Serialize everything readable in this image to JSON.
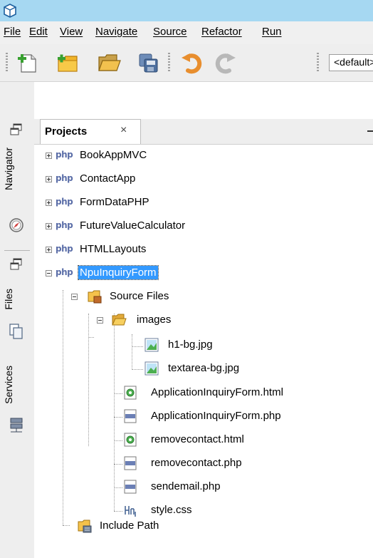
{
  "menubar": {
    "items": [
      "File",
      "Edit",
      "View",
      "Navigate",
      "Source",
      "Refactor",
      "Run"
    ]
  },
  "toolbar": {
    "buttons": [
      "new-file-icon",
      "new-project-icon",
      "open-project-icon",
      "save-all-icon",
      "undo-icon",
      "redo-icon"
    ],
    "config_value": "<default>"
  },
  "side_tabs": {
    "navigator": "Navigator",
    "files": "Files",
    "services": "Services"
  },
  "projects_panel": {
    "tab_label": "Projects",
    "close_glyph": "×",
    "projects": [
      "BookAppMVC",
      "ContactApp",
      "FormDataPHP",
      "FutureValueCalculator",
      "HTMLLayouts",
      "NpuInquiryForm"
    ],
    "php_badge": "php",
    "source_files": "Source Files",
    "images_folder": "images",
    "image_files": [
      "h1-bg.jpg",
      "textarea-bg.jpg"
    ],
    "files": [
      "ApplicationInquiryForm.html",
      "ApplicationInquiryForm.php",
      "removecontact.html",
      "removecontact.php",
      "sendemail.php",
      "style.css"
    ],
    "include_path": "Include Path"
  }
}
